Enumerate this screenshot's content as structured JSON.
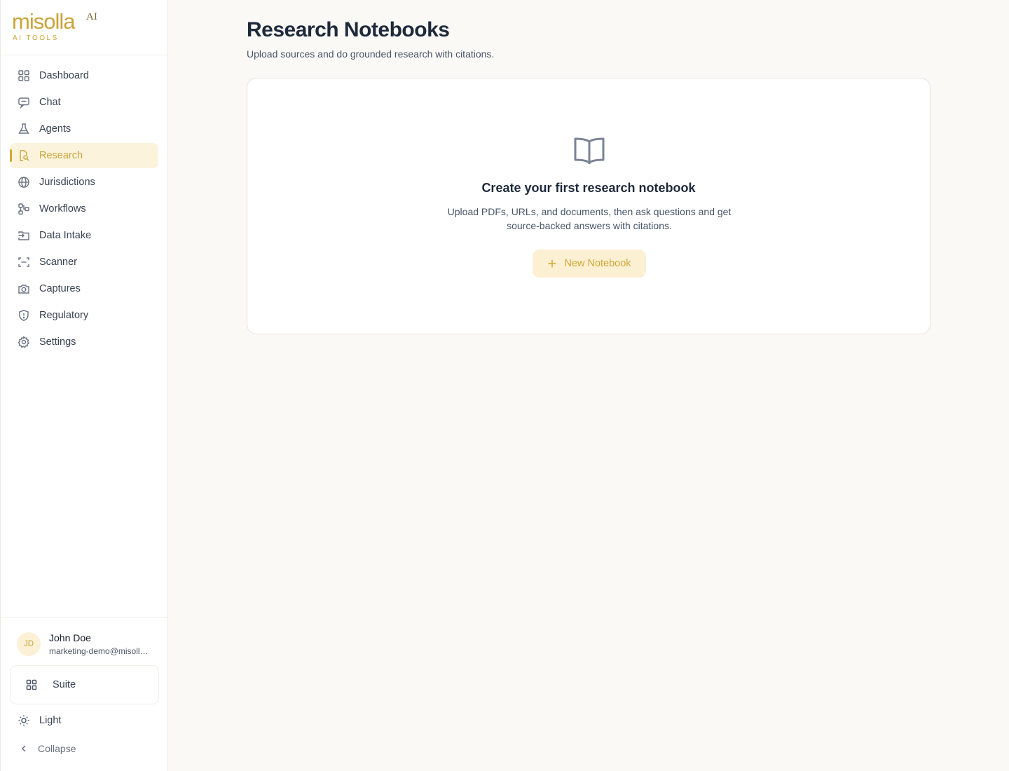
{
  "brand": {
    "wordmark": "misolla",
    "superscript": "AI",
    "tagline": "AI TOOLS"
  },
  "sidebar": {
    "items": [
      {
        "label": "Dashboard",
        "icon": "dashboard-icon"
      },
      {
        "label": "Chat",
        "icon": "chat-icon"
      },
      {
        "label": "Agents",
        "icon": "flask-icon"
      },
      {
        "label": "Research",
        "icon": "research-icon",
        "active": true
      },
      {
        "label": "Jurisdictions",
        "icon": "globe-icon"
      },
      {
        "label": "Workflows",
        "icon": "workflow-icon"
      },
      {
        "label": "Data Intake",
        "icon": "folder-input-icon"
      },
      {
        "label": "Scanner",
        "icon": "scan-icon"
      },
      {
        "label": "Captures",
        "icon": "camera-icon"
      },
      {
        "label": "Regulatory",
        "icon": "shield-icon"
      },
      {
        "label": "Settings",
        "icon": "gear-icon"
      }
    ]
  },
  "user": {
    "initials": "JD",
    "name": "John Doe",
    "email": "marketing-demo@misolla.ai"
  },
  "footer": {
    "suite_label": "Suite",
    "theme_label": "Light",
    "collapse_label": "Collapse"
  },
  "main": {
    "title": "Research Notebooks",
    "subtitle": "Upload sources and do grounded research with citations.",
    "empty": {
      "title": "Create your first research notebook",
      "description": "Upload PDFs, URLs, and documents, then ask questions and get source-backed answers with citations.",
      "button_label": "New Notebook"
    }
  },
  "colors": {
    "accent": "#c9a43a",
    "active_bg": "#fbf3dc",
    "background": "#faf9f6"
  }
}
